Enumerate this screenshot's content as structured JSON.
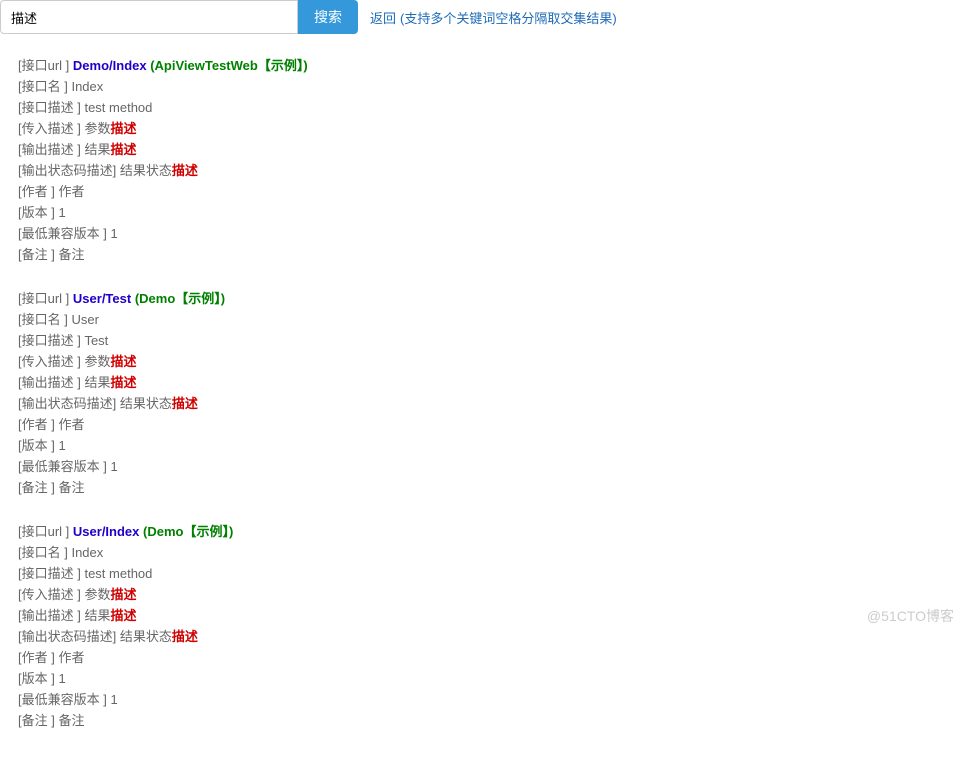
{
  "search": {
    "value": "描述",
    "button": "搜索",
    "back": "返回",
    "hint": "(支持多个关键词空格分隔取交集结果)"
  },
  "labels": {
    "url": "[接口url ] ",
    "name": "[接口名 ] ",
    "desc": "[接口描述 ] ",
    "input": "[传入描述 ] ",
    "output": "[输出描述 ] ",
    "status": "[输出状态码描述] ",
    "author": "[作者 ] ",
    "version": "[版本 ] ",
    "minver": "[最低兼容版本 ] ",
    "remark": "[备注 ] "
  },
  "highlight": "描述",
  "entries": [
    {
      "url": "Demo/Index",
      "group": "ApiViewTestWeb",
      "example": "【示例】",
      "name": "Index",
      "desc": "test method",
      "input_prefix": "参数",
      "output_prefix": "结果",
      "status_prefix": "结果状态",
      "author": "作者",
      "version": "1",
      "minver": "1",
      "remark": "备注"
    },
    {
      "url": "User/Test",
      "group": "Demo",
      "example": "【示例】",
      "name": "User",
      "desc": "Test",
      "input_prefix": "参数",
      "output_prefix": "结果",
      "status_prefix": "结果状态",
      "author": "作者",
      "version": "1",
      "minver": "1",
      "remark": "备注"
    },
    {
      "url": "User/Index",
      "group": "Demo",
      "example": "【示例】",
      "name": "Index",
      "desc": "test method",
      "input_prefix": "参数",
      "output_prefix": "结果",
      "status_prefix": "结果状态",
      "author": "作者",
      "version": "1",
      "minver": "1",
      "remark": "备注"
    }
  ],
  "watermark": "@51CTO博客"
}
